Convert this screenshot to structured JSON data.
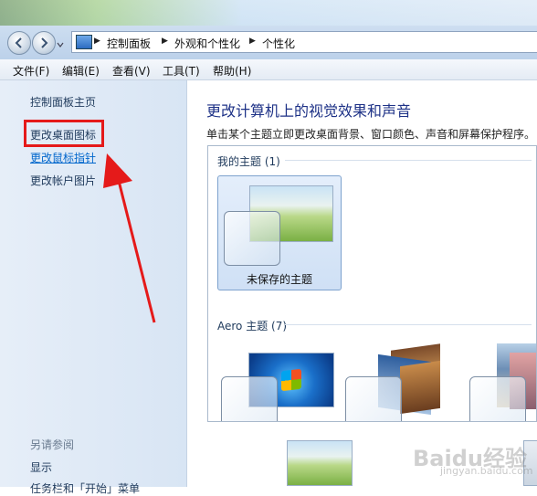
{
  "address": {
    "crumbs": [
      "控制面板",
      "外观和个性化",
      "个性化"
    ]
  },
  "menu": [
    "文件(F)",
    "编辑(E)",
    "查看(V)",
    "工具(T)",
    "帮助(H)"
  ],
  "left": {
    "home": "控制面板主页",
    "links": [
      "更改桌面图标",
      "更改鼠标指针",
      "更改帐户图片"
    ],
    "see_also": "另请参阅",
    "see_also_items": [
      "显示",
      "任务栏和「开始」菜单"
    ]
  },
  "main": {
    "title": "更改计算机上的视觉效果和声音",
    "description": "单击某个主题立即更改桌面背景、窗口颜色、声音和屏幕保护程序。",
    "my_themes_label": "我的主题 (1)",
    "unsaved_theme": "未保存的主题",
    "aero_label": "Aero 主题 (7)"
  },
  "watermark": {
    "brand": "Baidu经验",
    "url": "jingyan.baidu.com"
  },
  "colors": {
    "highlight": "#e51a1a",
    "link": "#0066cc",
    "title": "#1e3287"
  }
}
